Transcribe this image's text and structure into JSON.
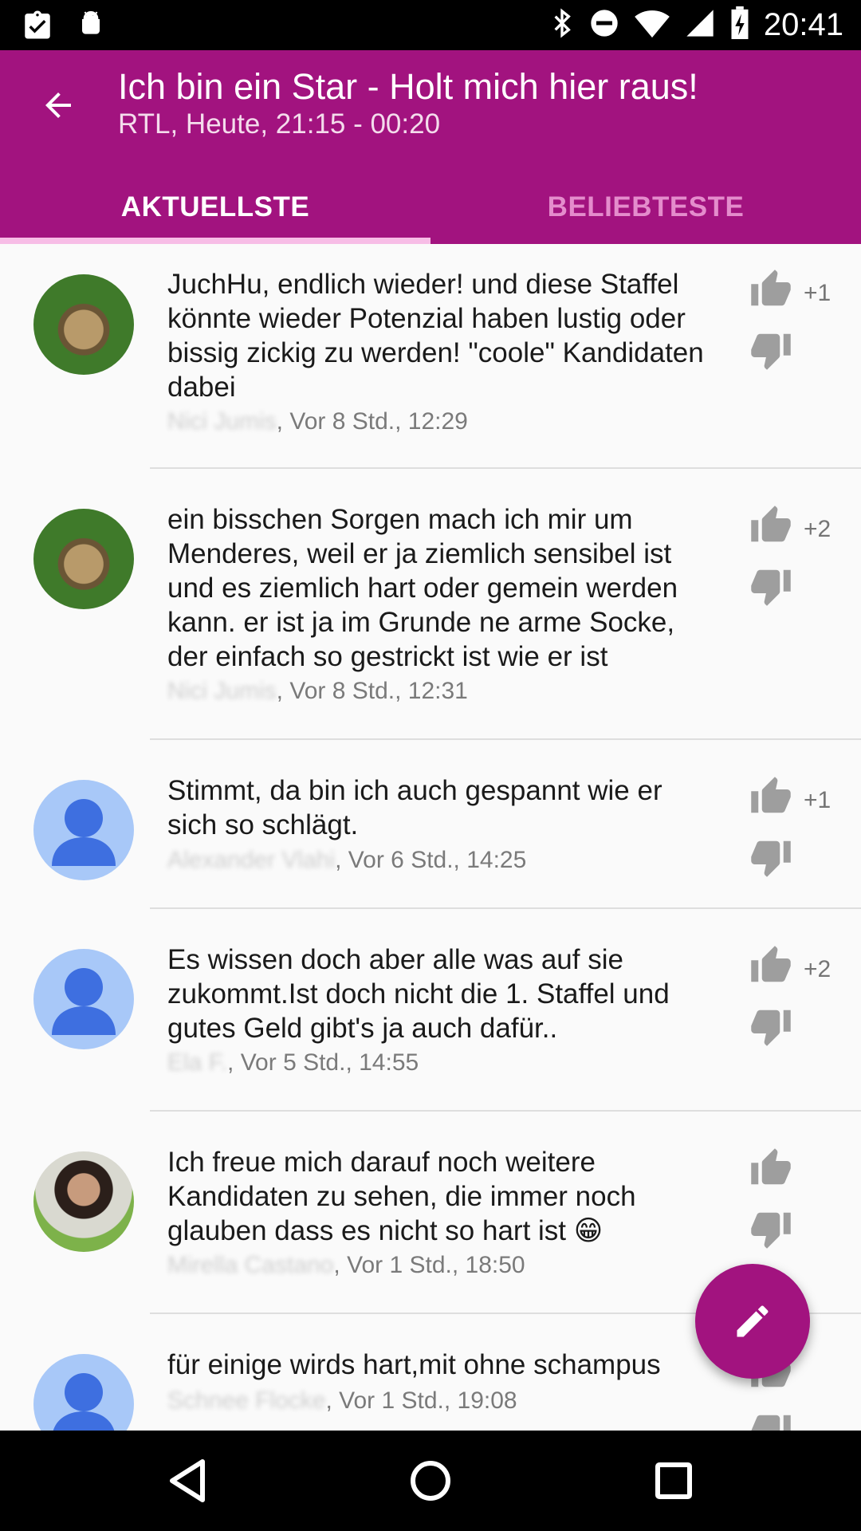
{
  "status_bar": {
    "time": "20:41",
    "icons": [
      "clipboard-check-icon",
      "android-icon",
      "bluetooth-icon",
      "do-not-disturb-icon",
      "wifi-icon",
      "signal-icon",
      "battery-charging-icon"
    ]
  },
  "app_bar": {
    "title": "Ich bin ein Star - Holt mich hier raus!",
    "subtitle": "RTL, Heute, 21:15 - 00:20",
    "back_icon": "arrow-back-icon",
    "color": "#a2137f"
  },
  "tabs": [
    {
      "label": "AKTUELLSTE",
      "active": true
    },
    {
      "label": "BELIEBTESTE",
      "active": false
    }
  ],
  "comments": [
    {
      "text": "JuchHu,  endlich wieder! und diese Staffel könnte wieder Potenzial haben lustig oder bissig zickig zu werden! \"coole\" Kandidaten dabei",
      "author": "Nici Jumis",
      "time": ", Vor 8 Std., 12:29",
      "score": "+1",
      "avatar": "dog-photo"
    },
    {
      "text": "ein bisschen Sorgen mach ich mir um Menderes, weil er ja ziemlich sensibel ist und es ziemlich hart oder gemein werden kann. er ist ja im Grunde ne arme Socke, der einfach so gestrickt ist wie er ist",
      "author": "Nici Jumis",
      "time": ", Vor 8 Std., 12:31",
      "score": "+2",
      "avatar": "dog-photo"
    },
    {
      "text": "Stimmt, da bin ich auch gespannt wie er sich so schlägt.",
      "author": "Alexander Vlahi",
      "time": ", Vor 6 Std., 14:25",
      "score": "+1",
      "avatar": "default-person"
    },
    {
      "text": "Es wissen doch aber alle was auf sie zukommt.Ist doch nicht die 1. Staffel und gutes Geld gibt's ja auch dafür..",
      "author": "Ela F.",
      "time": ", Vor 5 Std., 14:55",
      "score": "+2",
      "avatar": "default-person"
    },
    {
      "text": "Ich freue mich darauf noch weitere Kandidaten zu sehen, die immer noch glauben dass es nicht so hart ist 😁",
      "author": "Mirella Castano",
      "time": ", Vor 1 Std., 18:50",
      "score": "",
      "avatar": "girl-photo"
    },
    {
      "text": "für einige wirds hart,mit ohne schampus",
      "author": "Schnee Flocke",
      "time": ", Vor 1 Std., 19:08",
      "score": "",
      "avatar": "default-person"
    }
  ],
  "fab": {
    "icon": "pencil-edit-icon"
  },
  "nav_bar": {
    "icons": [
      "back-triangle-icon",
      "home-circle-icon",
      "recents-square-icon"
    ]
  }
}
